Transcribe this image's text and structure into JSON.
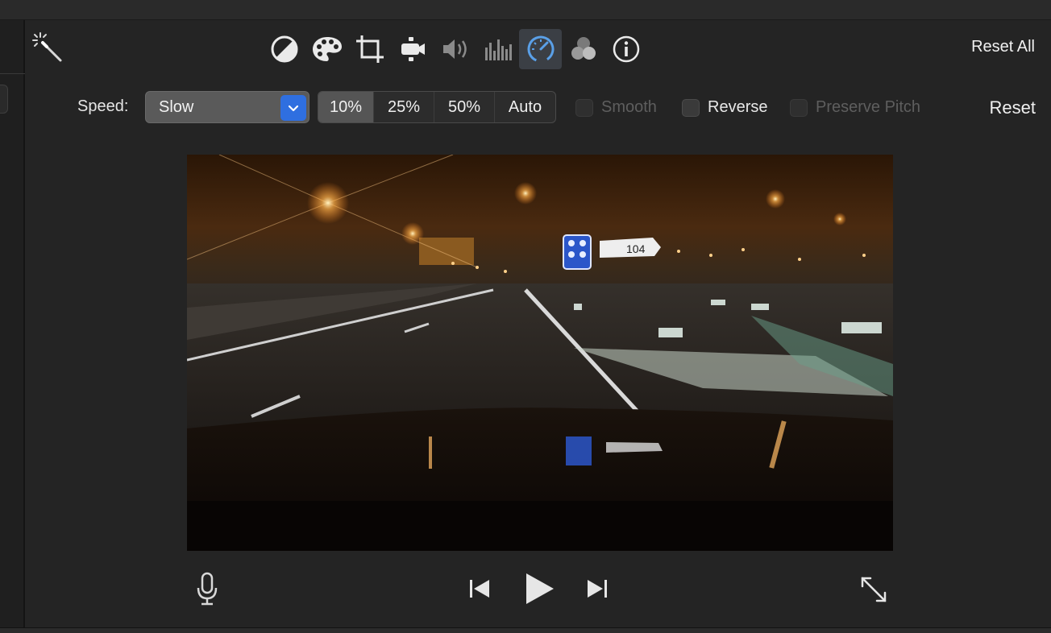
{
  "window": {
    "title": "Speed"
  },
  "toolbar": {
    "magic": "magic-wand-icon",
    "tools": [
      {
        "name": "color-balance-icon"
      },
      {
        "name": "color-correction-palette-icon"
      },
      {
        "name": "crop-icon"
      },
      {
        "name": "stabilization-camera-icon"
      },
      {
        "name": "volume-icon"
      },
      {
        "name": "noise-equalizer-icon"
      },
      {
        "name": "speed-icon"
      },
      {
        "name": "clip-filter-icon"
      },
      {
        "name": "info-icon"
      }
    ],
    "reset_all": "Reset All"
  },
  "speed": {
    "label": "Speed:",
    "selected": "Slow",
    "options": [
      "10%",
      "25%",
      "50%",
      "Auto"
    ],
    "selected_option": "10%",
    "smooth": "Smooth",
    "reverse": "Reverse",
    "preserve_pitch": "Preserve Pitch",
    "reset": "Reset"
  },
  "viewer": {
    "sign_text": "104"
  },
  "playback": {
    "mic": "microphone-icon",
    "prev": "skip-back-icon",
    "play": "play-icon",
    "next": "skip-forward-icon",
    "fullscreen": "fullscreen-icon"
  },
  "colors": {
    "accent": "#2f6fe0",
    "active_tool": "#5aa0e8"
  }
}
